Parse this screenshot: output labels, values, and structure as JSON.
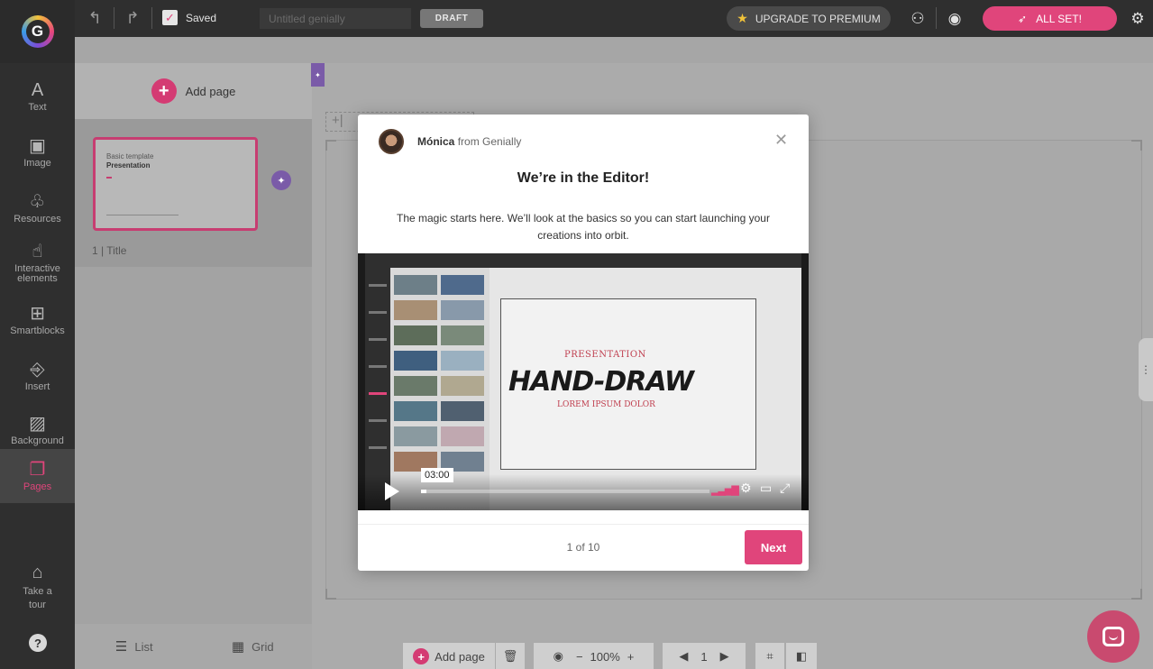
{
  "topbar": {
    "logo_letter": "G",
    "undo_icon": "undo-icon",
    "redo_icon": "redo-icon",
    "saved_label": "Saved",
    "title_placeholder": "Untitled genially",
    "draft_label": "DRAFT",
    "upgrade_label": "UPGRADE TO PREMIUM",
    "allset_label": "ALL SET!"
  },
  "sidebar": {
    "items": [
      {
        "label": "Text",
        "icon": "A"
      },
      {
        "label": "Image",
        "icon": "▣"
      },
      {
        "label": "Resources",
        "icon": "♧"
      },
      {
        "label": "Interactive elements",
        "icon": "☝"
      },
      {
        "label": "Smartblocks",
        "icon": "⊞"
      },
      {
        "label": "Insert",
        "icon": "⎆"
      },
      {
        "label": "Background",
        "icon": "▨"
      },
      {
        "label": "Pages",
        "icon": "❐"
      }
    ],
    "tour_label": "Take a tour",
    "help_label": "?"
  },
  "pages_panel": {
    "add_page_label": "Add page",
    "thumb_line1": "Basic template",
    "thumb_line2": "Presentation",
    "page_label": "1 | Title",
    "list_label": "List",
    "grid_label": "Grid"
  },
  "bottom_toolbar": {
    "add_page_label": "Add page",
    "zoom": "100%",
    "page_number": "1"
  },
  "modal": {
    "sender_name": "Mónica",
    "sender_from": "from Genially",
    "title": "We’re in the Editor!",
    "body": "The magic starts here. We’ll look at the basics so you can start launching your creations into orbit.",
    "video": {
      "slide_small": "PRESENTATION",
      "slide_big": "HAND-DRAW",
      "slide_sub": "LOREM IPSUM DOLOR",
      "timecode": "03:00",
      "progress": 0.02
    },
    "counter": "1 of 10",
    "next_label": "Next"
  },
  "colors": {
    "accent": "#e0457b",
    "dark": "#2f2f2f",
    "purple": "#7a5ba8"
  }
}
